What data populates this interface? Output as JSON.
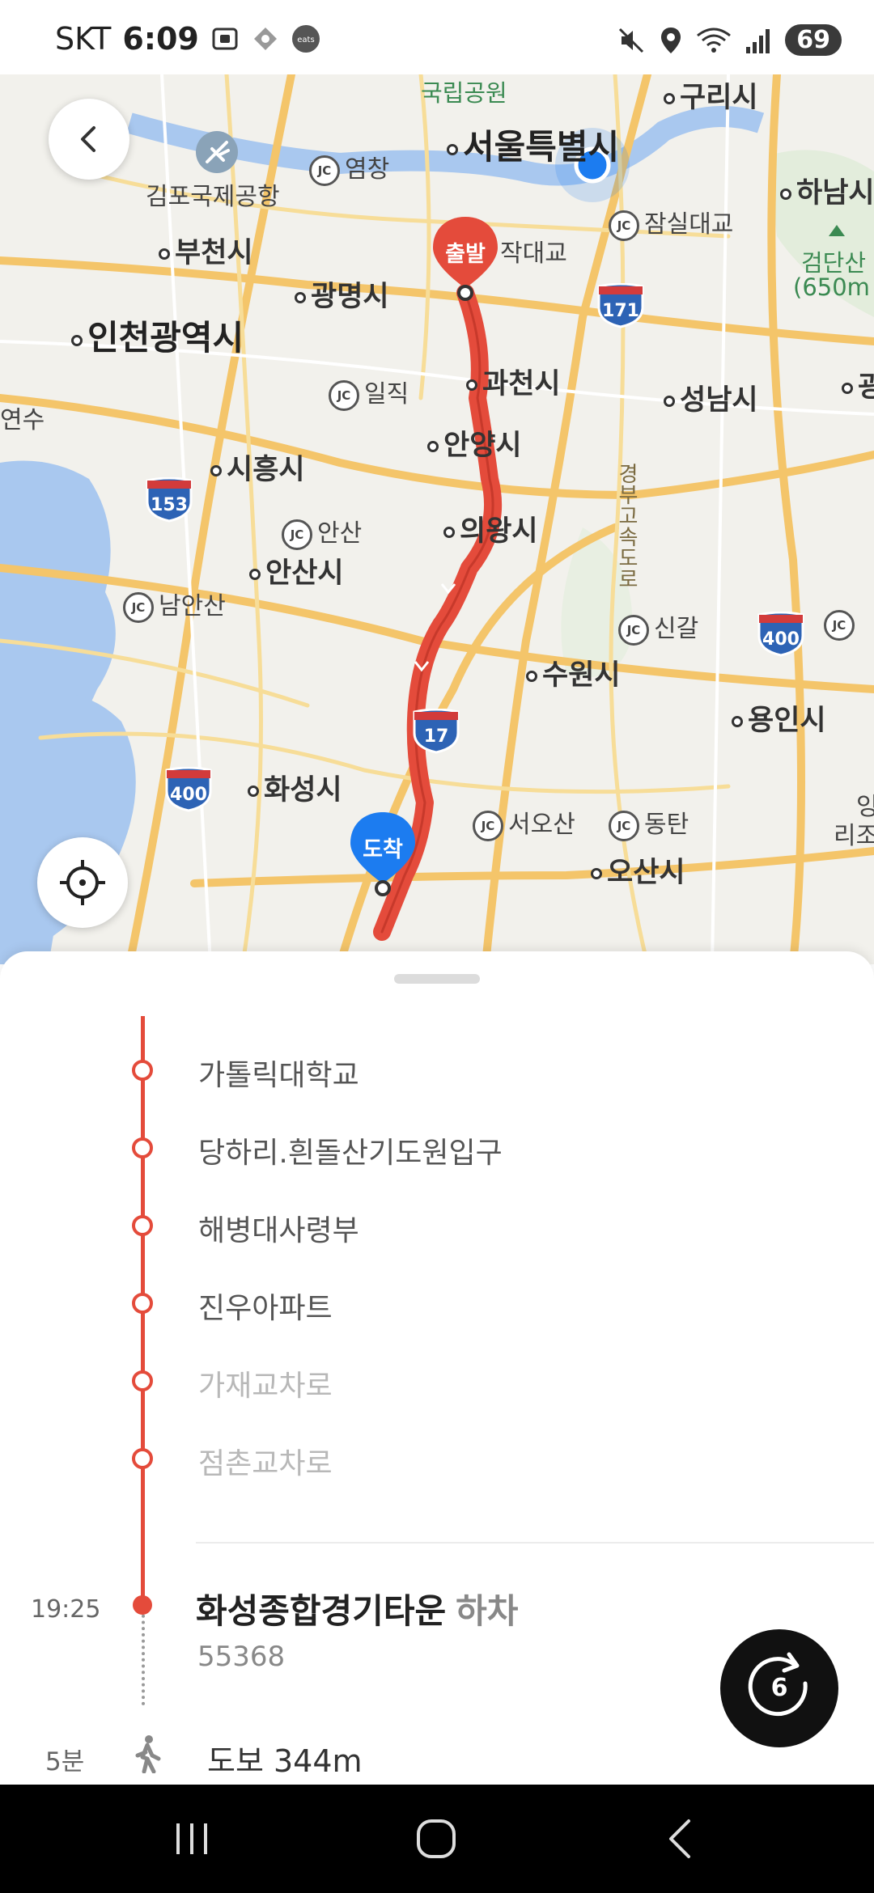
{
  "status_bar": {
    "carrier": "SKT",
    "time": "6:09",
    "battery": "69",
    "icons": [
      "screenshot-icon",
      "app-notification-icon",
      "coupang-eats-icon",
      "mute-icon",
      "location-icon",
      "wifi-icon",
      "signal-icon"
    ]
  },
  "map": {
    "labels": {
      "national_park": "국립공원",
      "guri": "구리시",
      "seoul": "서울특별시",
      "hanam": "하남시",
      "gimpo_airport": "김포국제공항",
      "yeomchang": "염창",
      "jamsil_bridge": "잠실대교",
      "geomdan_mountain": "검단산",
      "geomdan_height": "(650m",
      "bucheon": "부천시",
      "dongjak_bridge": "작대교",
      "gwangmyeong": "광명시",
      "incheon": "인천광역시",
      "iljik": "일직",
      "gwacheon": "과천시",
      "seongnam": "성남시",
      "gwang_partial": "광",
      "yeonsu": "연수",
      "anyang": "안양시",
      "siheung": "시흥시",
      "expressway": "경부고속도로",
      "ansan_jc": "안산",
      "uiwang": "의왕시",
      "ansan_city": "안산시",
      "namansan": "남안산",
      "singal": "신갈",
      "suwon": "수원시",
      "yongin": "용인시",
      "hwaseong": "화성시",
      "seosan": "서오산",
      "dongtan": "동탄",
      "osan": "오산시",
      "right_partial_1": "잉",
      "right_partial_2": "리조"
    },
    "shields": {
      "s171": "171",
      "s153": "153",
      "s400a": "400",
      "s17": "17",
      "s400b": "400"
    },
    "start_pin": "출발",
    "end_pin": "도착",
    "route_color": "#e44b3b",
    "end_pin_color": "#1c7cf0"
  },
  "route": {
    "stops": [
      {
        "name": "가톨릭대학교",
        "passed": false
      },
      {
        "name": "당하리.흰돌산기도원입구",
        "passed": false
      },
      {
        "name": "해병대사령부",
        "passed": false
      },
      {
        "name": "진우아파트",
        "passed": false
      },
      {
        "name": "가재교차로",
        "passed": true
      },
      {
        "name": "점촌교차로",
        "passed": true
      }
    ],
    "arrival": {
      "time": "19:25",
      "name": "화성종합경기타운",
      "suffix": "하차",
      "code": "55368"
    },
    "walk": {
      "time": "5분",
      "text": "도보 344m"
    },
    "refresh_count": "6"
  }
}
